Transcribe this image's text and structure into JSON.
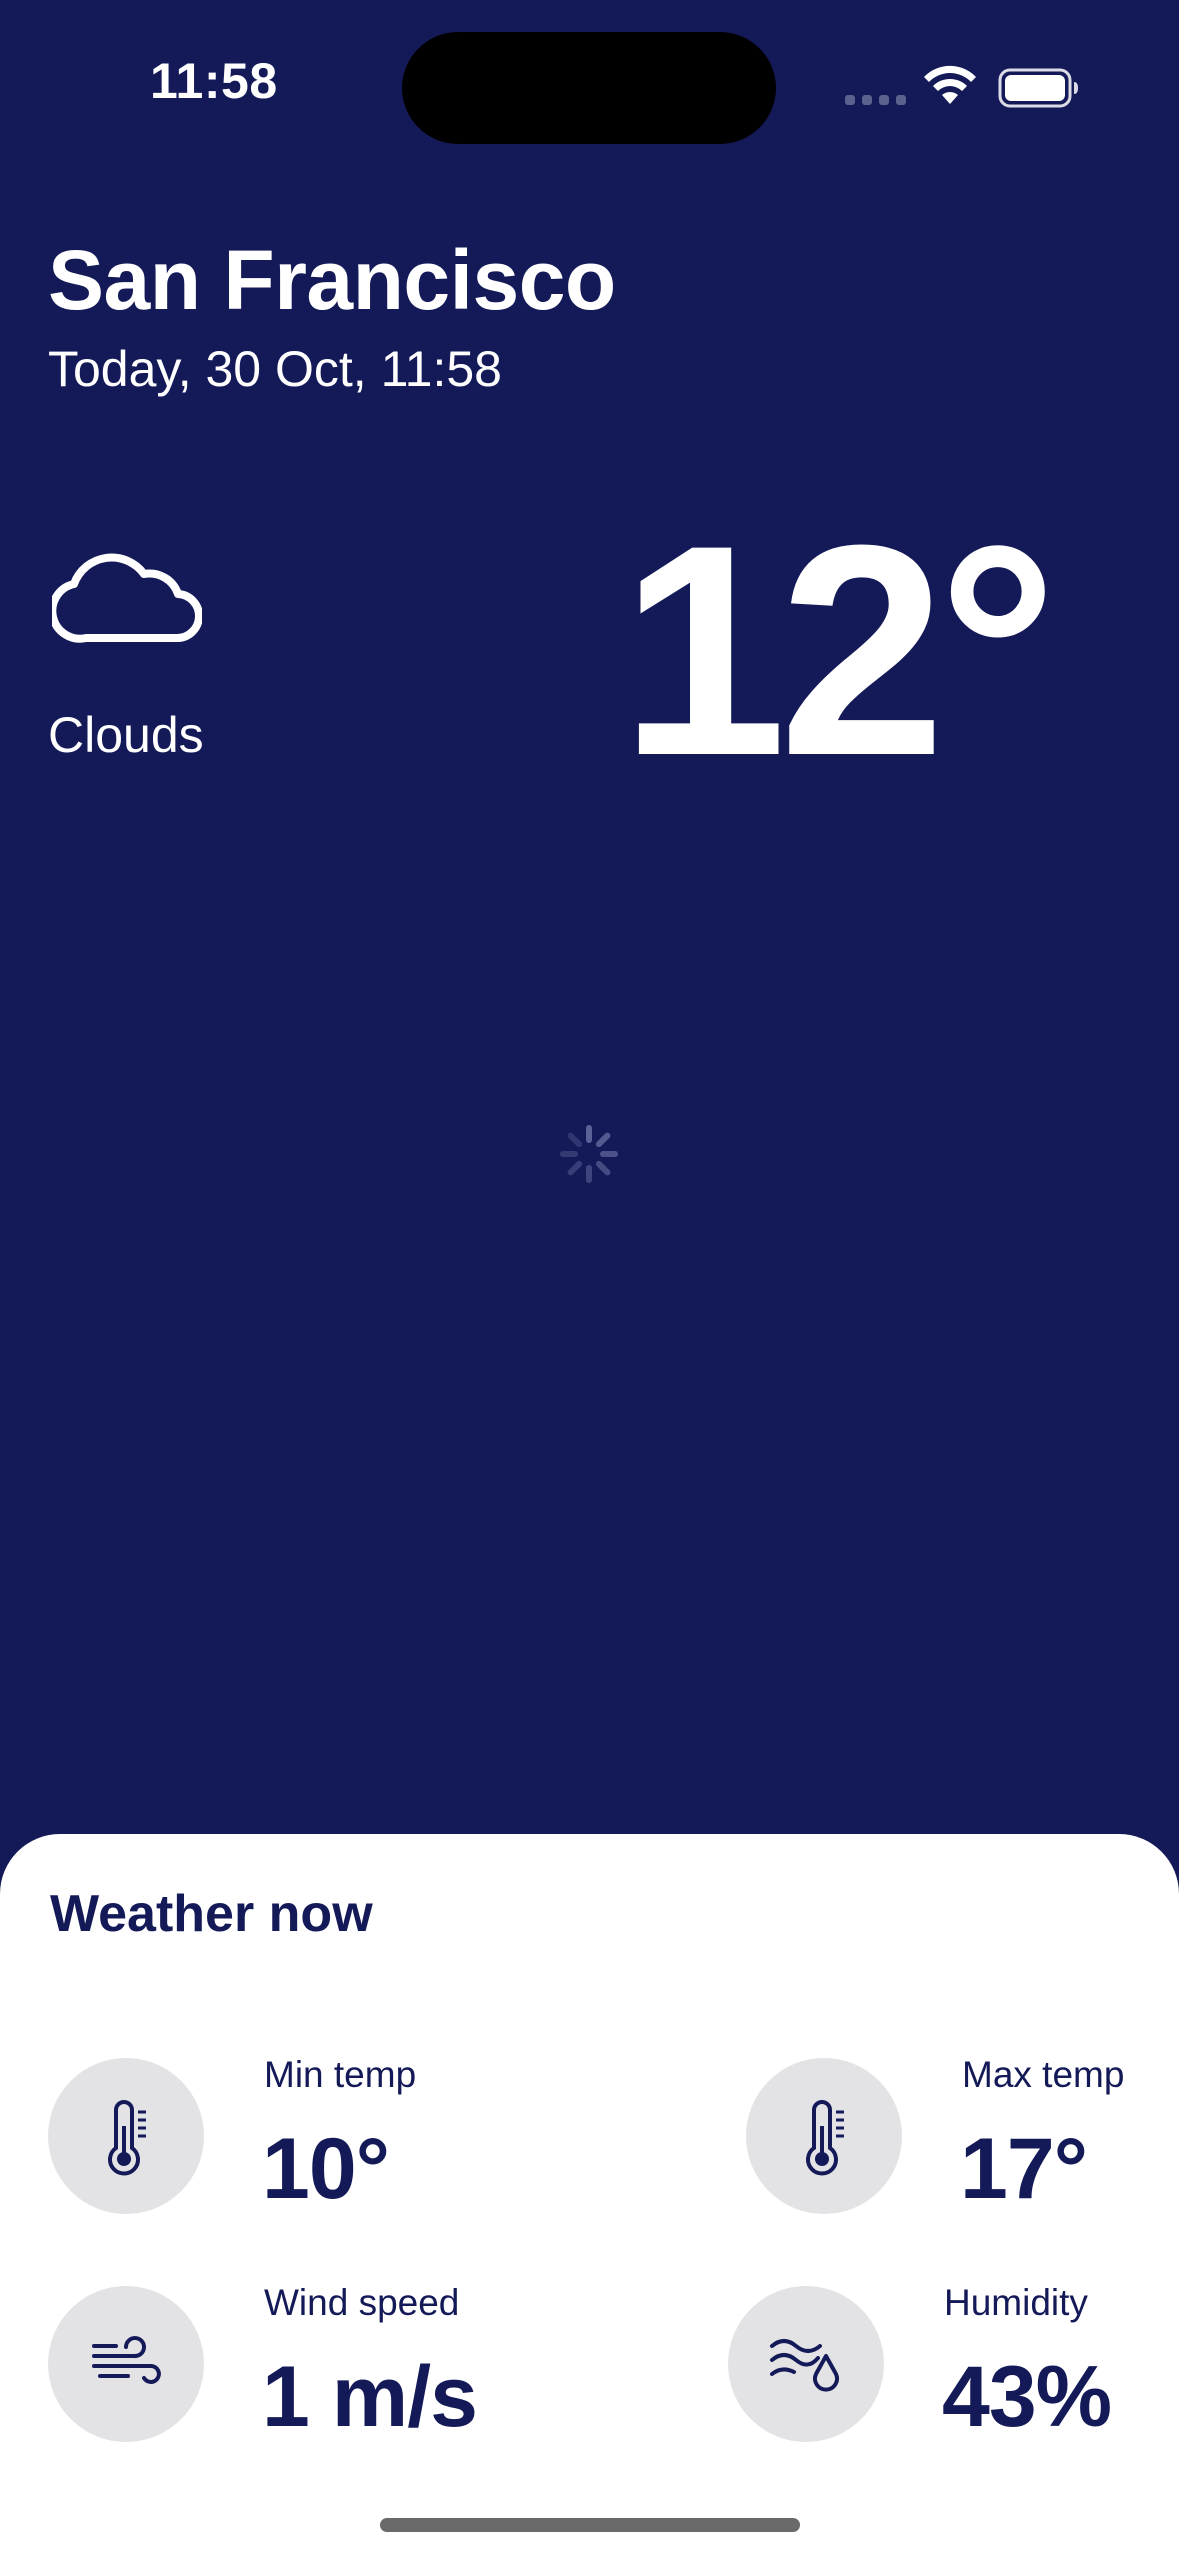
{
  "status_bar": {
    "time": "11:58"
  },
  "header": {
    "city": "San Francisco",
    "date": "Today, 30 Oct, 11:58"
  },
  "current": {
    "icon": "cloud-icon",
    "condition": "Clouds",
    "temperature": "12°"
  },
  "loading_indicator": "spinner-icon",
  "sheet": {
    "title": "Weather now",
    "stats": {
      "min_temp": {
        "label": "Min temp",
        "value": "10°",
        "icon": "thermometer-icon"
      },
      "max_temp": {
        "label": "Max temp",
        "value": "17°",
        "icon": "thermometer-icon"
      },
      "wind_speed": {
        "label": "Wind speed",
        "value": "1 m/s",
        "icon": "wind-icon"
      },
      "humidity": {
        "label": "Humidity",
        "value": "43%",
        "icon": "humidity-icon"
      }
    }
  },
  "colors": {
    "background": "#141A58",
    "sheet": "#FFFFFF",
    "icon_circle": "#E3E3E6",
    "text_dark": "#141A58"
  }
}
